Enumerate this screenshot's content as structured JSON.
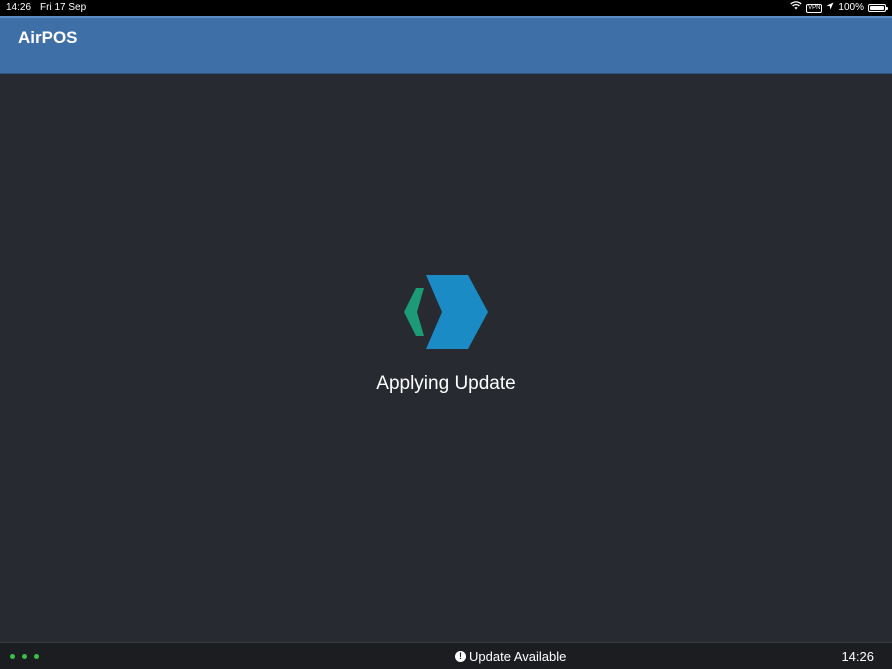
{
  "status_bar": {
    "time": "14:26",
    "date": "Fri 17 Sep",
    "vpn_label": "VPN",
    "battery_text": "100%",
    "battery_level": 1.0,
    "icons": [
      "wifi-icon",
      "vpn-icon",
      "location-arrow-icon",
      "battery-icon"
    ]
  },
  "header": {
    "title": "AirPOS"
  },
  "main": {
    "logo_icon": "airpos-logo-icon",
    "status_text": "Applying Update"
  },
  "footer": {
    "connection_dots": 3,
    "update_icon": "info-icon",
    "update_text": "Update Available",
    "time": "14:26"
  },
  "colors": {
    "header_bg": "#3e6fa7",
    "body_bg": "#272a31",
    "footer_bg": "#1b1d21",
    "logo_green": "#1d9a76",
    "logo_blue": "#1a8bc4",
    "dot_green": "#3cbf4a"
  }
}
